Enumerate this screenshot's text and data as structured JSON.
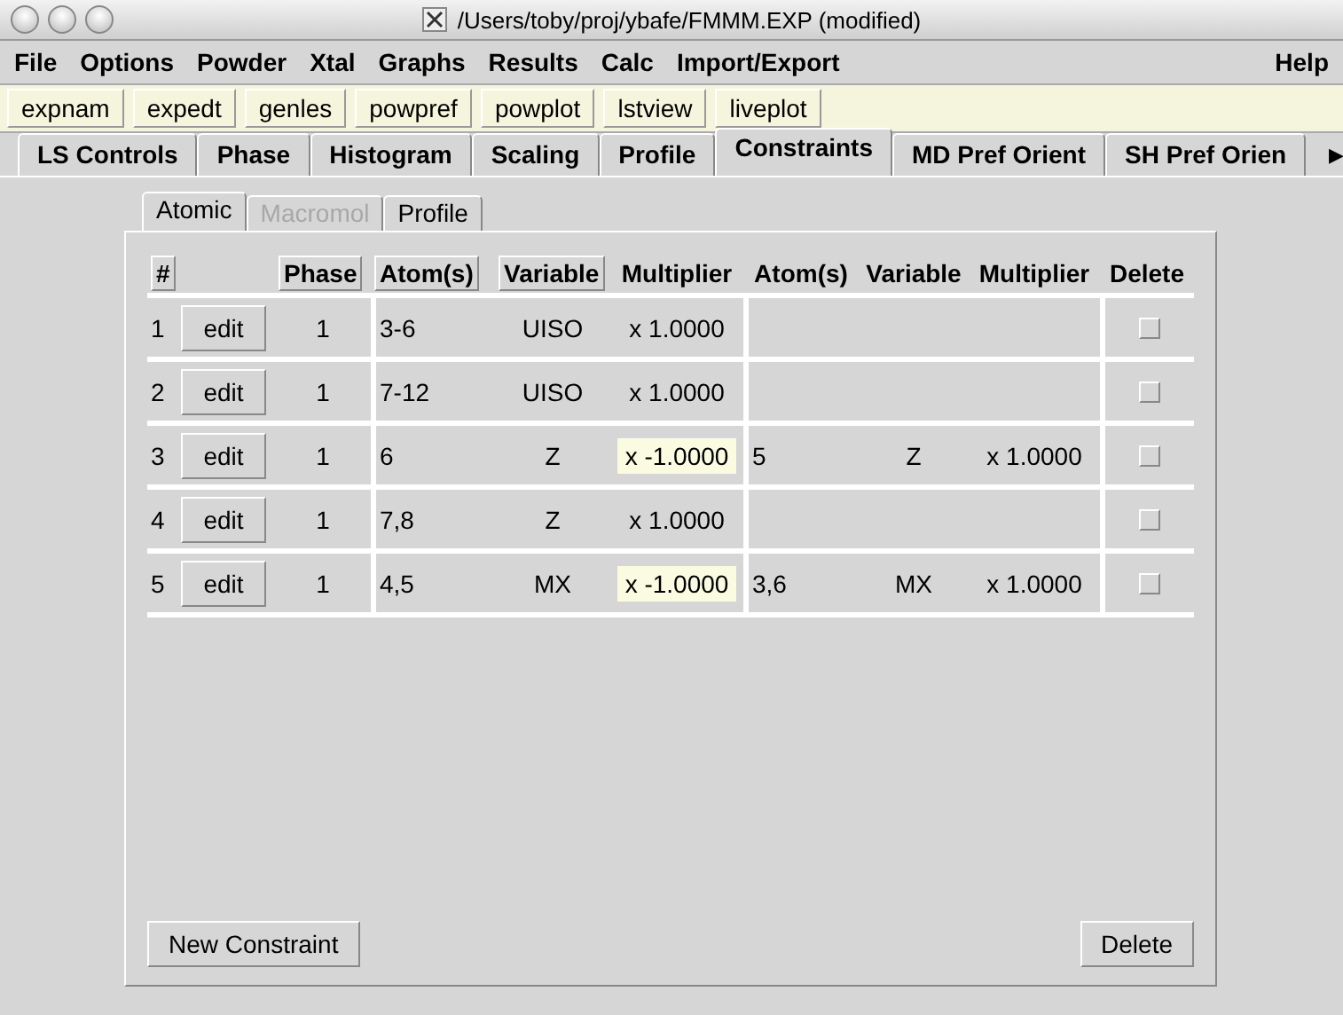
{
  "window": {
    "title": "/Users/toby/proj/ybafe/FMMM.EXP (modified)"
  },
  "menu": {
    "items": [
      "File",
      "Options",
      "Powder",
      "Xtal",
      "Graphs",
      "Results",
      "Calc",
      "Import/Export"
    ],
    "help": "Help"
  },
  "toolbar": [
    "expnam",
    "expedt",
    "genles",
    "powpref",
    "powplot",
    "lstview",
    "liveplot"
  ],
  "tabs": [
    {
      "label": "LS Controls",
      "selected": false
    },
    {
      "label": "Phase",
      "selected": false
    },
    {
      "label": "Histogram",
      "selected": false
    },
    {
      "label": "Scaling",
      "selected": false
    },
    {
      "label": "Profile",
      "selected": false
    },
    {
      "label": "Constraints",
      "selected": true
    },
    {
      "label": "MD Pref Orient",
      "selected": false
    },
    {
      "label": "SH Pref Orien",
      "selected": false
    }
  ],
  "tab_scroll": "▶",
  "subtabs": [
    {
      "label": "Atomic",
      "selected": true,
      "disabled": false
    },
    {
      "label": "Macromol",
      "selected": false,
      "disabled": true
    },
    {
      "label": "Profile",
      "selected": false,
      "disabled": false
    }
  ],
  "columns": [
    {
      "label": "#",
      "kind": "button"
    },
    {
      "kind": "blank"
    },
    {
      "label": "Phase",
      "kind": "button"
    },
    {
      "label": "Atom(s)",
      "kind": "button"
    },
    {
      "label": "Variable",
      "kind": "button"
    },
    {
      "label": "Multiplier",
      "kind": "text"
    },
    {
      "label": "Atom(s)",
      "kind": "text"
    },
    {
      "label": "Variable",
      "kind": "text"
    },
    {
      "label": "Multiplier",
      "kind": "text"
    },
    {
      "label": "Delete",
      "kind": "text"
    }
  ],
  "rows": [
    {
      "num": "1",
      "edit": "edit",
      "phase": "1",
      "atoms": "3-6",
      "variable": "UISO",
      "multiplier": "x 1.0000",
      "highlighted": false,
      "delete": false
    },
    {
      "num": "2",
      "edit": "edit",
      "phase": "1",
      "atoms": "7-12",
      "variable": "UISO",
      "multiplier": "x 1.0000",
      "highlighted": false,
      "delete": false
    },
    {
      "num": "3",
      "edit": "edit",
      "phase": "1",
      "atoms": "6",
      "variable": "Z",
      "multiplier": "x -1.0000",
      "highlighted": true,
      "atoms2": "5",
      "variable2": "Z",
      "multiplier2": "x 1.0000",
      "delete": false
    },
    {
      "num": "4",
      "edit": "edit",
      "phase": "1",
      "atoms": "7,8",
      "variable": "Z",
      "multiplier": "x 1.0000",
      "highlighted": false,
      "delete": false
    },
    {
      "num": "5",
      "edit": "edit",
      "phase": "1",
      "atoms": "4,5",
      "variable": "MX",
      "multiplier": "x -1.0000",
      "highlighted": true,
      "atoms2": "3,6",
      "variable2": "MX",
      "multiplier2": "x 1.0000",
      "delete": false
    }
  ],
  "buttons": {
    "new": "New Constraint",
    "delete": "Delete"
  }
}
